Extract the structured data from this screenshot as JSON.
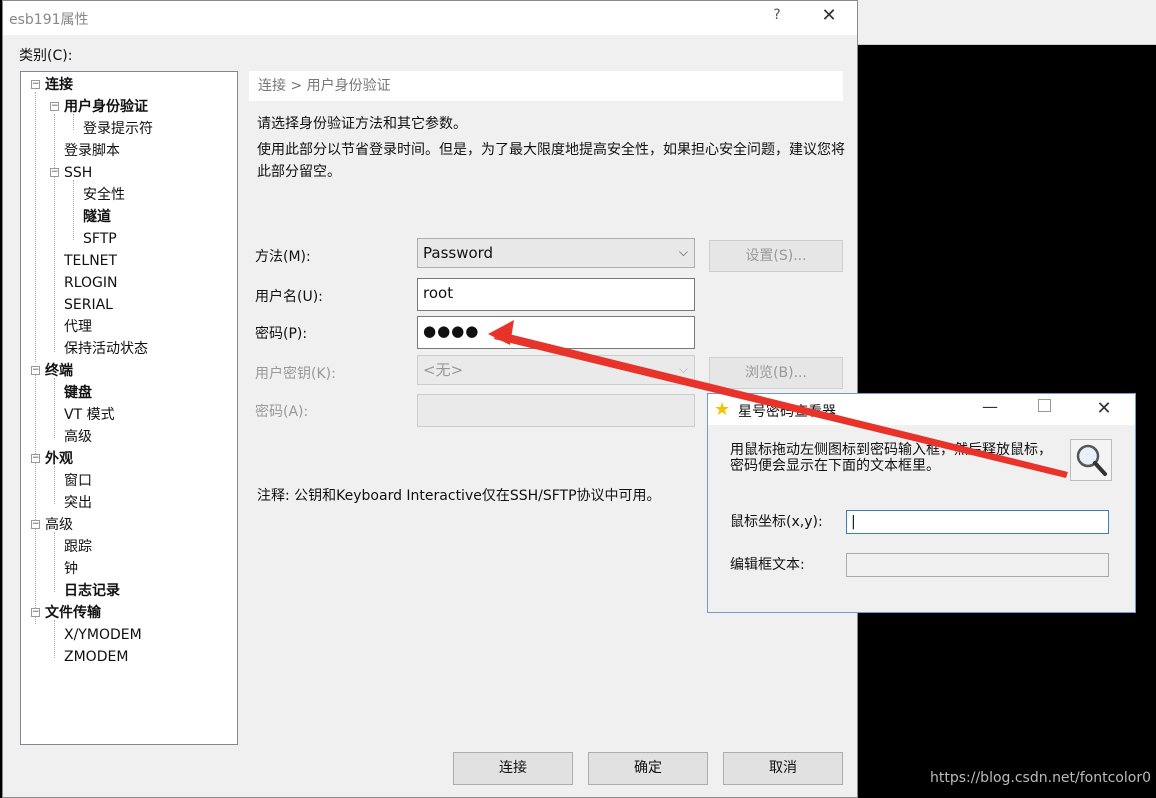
{
  "dialog": {
    "title": "esb191属性",
    "help": "?",
    "close": "✕",
    "category_label": "类别(C):"
  },
  "tree": [
    {
      "label": "连接",
      "bold": true
    },
    {
      "label": "用户身份验证",
      "bold": true,
      "selected": true
    },
    {
      "label": "登录提示符"
    },
    {
      "label": "登录脚本"
    },
    {
      "label": "SSH"
    },
    {
      "label": "安全性"
    },
    {
      "label": "隧道",
      "bold": true
    },
    {
      "label": "SFTP"
    },
    {
      "label": "TELNET"
    },
    {
      "label": "RLOGIN"
    },
    {
      "label": "SERIAL"
    },
    {
      "label": "代理"
    },
    {
      "label": "保持活动状态"
    },
    {
      "label": "终端",
      "bold": true
    },
    {
      "label": "键盘",
      "bold": true
    },
    {
      "label": "VT 模式"
    },
    {
      "label": "高级"
    },
    {
      "label": "外观",
      "bold": true
    },
    {
      "label": "窗口"
    },
    {
      "label": "突出"
    },
    {
      "label": "高级"
    },
    {
      "label": "跟踪"
    },
    {
      "label": "钟"
    },
    {
      "label": "日志记录",
      "bold": true
    },
    {
      "label": "文件传输",
      "bold": true
    },
    {
      "label": "X/YMODEM"
    },
    {
      "label": "ZMODEM"
    }
  ],
  "main": {
    "breadcrumb": "连接 > 用户身份验证",
    "desc1": "请选择身份验证方法和其它参数。",
    "desc2": "使用此部分以节省登录时间。但是，为了最大限度地提高安全性，如果担心安全问题，建议您将此部分留空。",
    "method_label": "方法(M):",
    "method_value": "Password",
    "settings_button": "设置(S)...",
    "username_label": "用户名(U):",
    "username_value": "root",
    "password_label": "密码(P):",
    "password_value": "●●●●",
    "userkey_label": "用户密钥(K):",
    "userkey_value": "<无>",
    "browse_button": "浏览(B)...",
    "passphrase_label": "密码(A):",
    "note": "注释: 公钥和Keyboard Interactive仅在SSH/SFTP协议中可用。"
  },
  "footer": {
    "connect": "连接",
    "ok": "确定",
    "cancel": "取消"
  },
  "tool": {
    "title": "星号密码查看器",
    "minimize": "—",
    "close": "✕",
    "instruction": "用鼠标拖动左侧图标到密码输入框，然后释放鼠标，密码便会显示在下面的文本框里。",
    "coord_label": "鼠标坐标(x,y):",
    "coord_value": "|",
    "editbox_label": "编辑框文本:",
    "editbox_value": ""
  },
  "watermark": "https://blog.csdn.net/fontcolor0",
  "colors": {
    "arrow": "#e8332a",
    "dialog_bg": "#f0f0f0",
    "tool_border": "#6e9bd1"
  }
}
